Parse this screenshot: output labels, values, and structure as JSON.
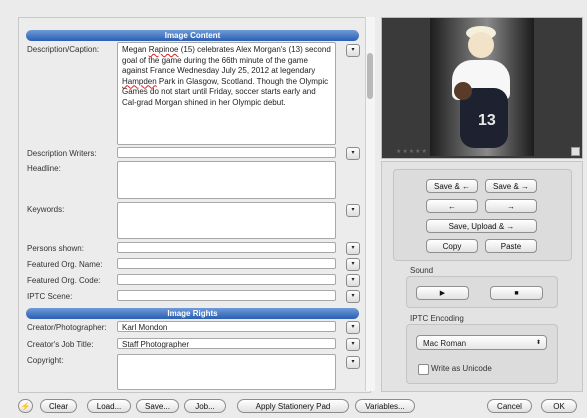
{
  "image_content": {
    "section_title": "Image Content",
    "description_label": "Description/Caption:",
    "description_pre": "Megan ",
    "description_misspelled": "Rapinoe",
    "description_mid": " (15) celebrates Alex Morgan's (13) second goal of the game during the 66th minute of the game against France Wednesday July 25, 2012 at legendary ",
    "description_misspelled2": "Hampden",
    "description_post": " Park in Glasgow, Scotland. Though the Olympic Games do not start until Friday, soccer starts early and Cal-grad Morgan shined in her Olympic debut.",
    "description_writers_label": "Description Writers:",
    "description_writers_value": "",
    "headline_label": "Headline:",
    "headline_value": "",
    "keywords_label": "Keywords:",
    "keywords_value": "",
    "persons_label": "Persons shown:",
    "persons_value": "",
    "featured_org_name_label": "Featured Org. Name:",
    "featured_org_name_value": "",
    "featured_org_code_label": "Featured Org. Code:",
    "featured_org_code_value": "",
    "iptc_scene_label": "IPTC Scene:",
    "iptc_scene_value": ""
  },
  "image_rights": {
    "section_title": "Image Rights",
    "creator_label": "Creator/Photographer:",
    "creator_value": "Karl Mondon",
    "job_title_label": "Creator's Job Title:",
    "job_title_value": "Staff Photographer",
    "copyright_label": "Copyright:",
    "copyright_value": ""
  },
  "popup_glyph": "▾",
  "preview": {
    "jersey_number": "13",
    "rating_stars": "★★★★★"
  },
  "controls": {
    "save_prev": "Save & ←",
    "save_next": "Save & →",
    "prev": "←",
    "next": "→",
    "save_upload_next": "Save, Upload & →",
    "copy": "Copy",
    "paste": "Paste",
    "sound_label": "Sound",
    "play_glyph": "▶",
    "stop_glyph": "■",
    "iptc_encoding_label": "IPTC Encoding",
    "encoding_value": "Mac Roman",
    "encoding_arrows": "⬍",
    "write_unicode_label": "Write as Unicode",
    "write_unicode_checked": false
  },
  "bottom_bar": {
    "lightning": "⚡",
    "clear": "Clear",
    "load": "Load...",
    "save": "Save...",
    "job": "Job...",
    "apply_stationery": "Apply Stationery Pad",
    "variables": "Variables...",
    "cancel": "Cancel",
    "ok": "OK"
  }
}
